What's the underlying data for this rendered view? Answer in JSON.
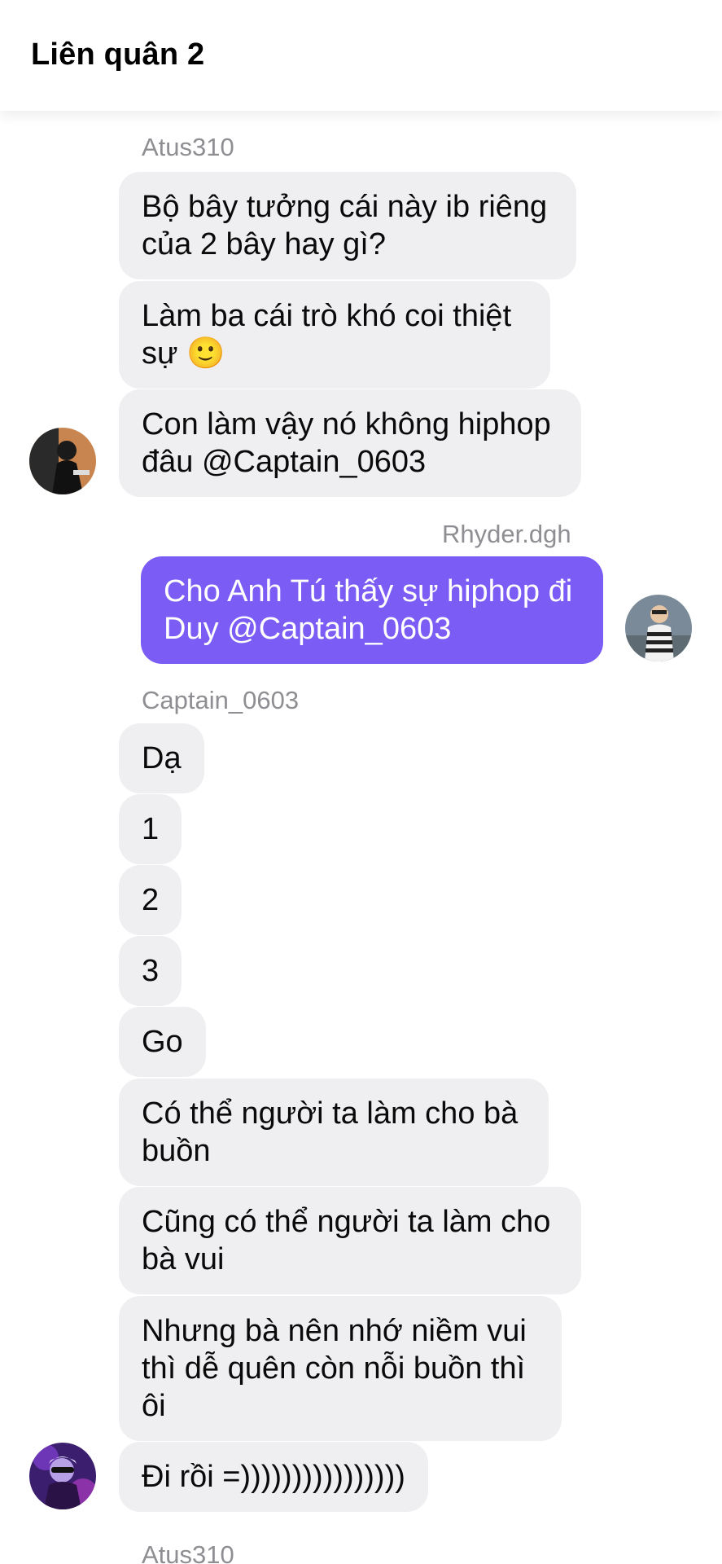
{
  "header": {
    "title": "Liên quân 2"
  },
  "groups": [
    {
      "sender": "Atus310",
      "messages": [
        "Bộ bây tưởng cái này ib riêng\ncủa 2 bây hay gì?",
        "Làm ba cái trò khó coi thiệt\nsự 🙂",
        "Con làm vậy nó không hiphop\nđâu @Captain_0603"
      ]
    },
    {
      "sender": "Rhyder.dgh",
      "outgoing": true,
      "messages": [
        "Cho Anh Tú thấy sự hiphop đi\nDuy @Captain_0603"
      ]
    },
    {
      "sender": "Captain_0603",
      "messages": [
        "Dạ",
        "1",
        "2",
        "3",
        "Go",
        "Có thể người ta làm cho bà\nbuồn",
        "Cũng có thể người ta làm cho\nbà vui",
        "Nhưng bà nên nhớ niềm vui\nthì dễ quên còn nỗi buồn thì\nôi",
        "Đi rồi =))))))))))))))))"
      ]
    },
    {
      "sender": "Atus310",
      "messages": []
    }
  ],
  "colors": {
    "outgoing_bubble": "#7b5cf5",
    "incoming_bubble": "#efeff1",
    "sender_name": "#8e8e93"
  },
  "avatars": [
    "avatar-atus310",
    "avatar-rhyder-dgh",
    "avatar-captain-0603"
  ]
}
